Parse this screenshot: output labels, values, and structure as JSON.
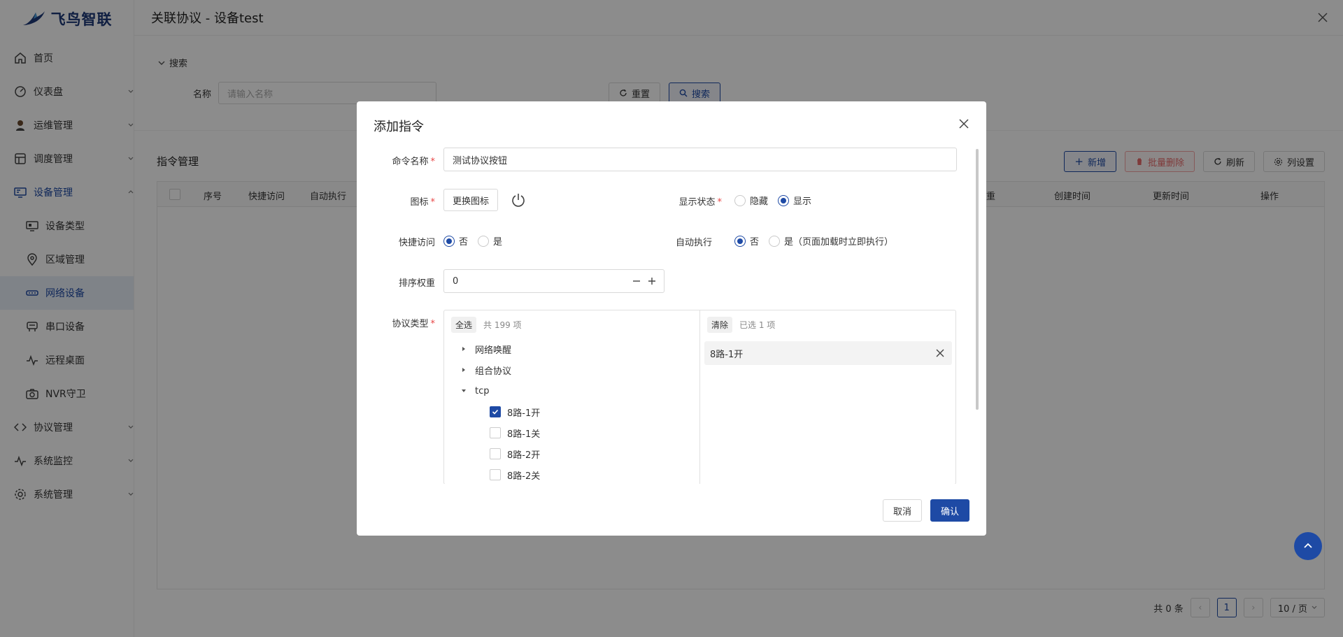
{
  "app": {
    "brand": "飞鸟智联",
    "brand_color": "#1e4aa5"
  },
  "sidebar": {
    "items": [
      {
        "label": "首页",
        "icon": "home-icon"
      },
      {
        "label": "仪表盘",
        "icon": "dashboard-icon"
      },
      {
        "label": "运维管理",
        "icon": "user-ops-icon"
      },
      {
        "label": "调度管理",
        "icon": "schedule-icon"
      },
      {
        "label": "设备管理",
        "icon": "monitor-icon"
      },
      {
        "label": "设备类型",
        "icon": "device-type-icon"
      },
      {
        "label": "区域管理",
        "icon": "location-icon"
      },
      {
        "label": "网络设备",
        "icon": "network-icon"
      },
      {
        "label": "串口设备",
        "icon": "serial-icon"
      },
      {
        "label": "远程桌面",
        "icon": "pulse-icon"
      },
      {
        "label": "NVR守卫",
        "icon": "camera-icon"
      },
      {
        "label": "协议管理",
        "icon": "code-icon"
      },
      {
        "label": "系统监控",
        "icon": "activity-icon"
      },
      {
        "label": "系统管理",
        "icon": "gear-icon"
      }
    ]
  },
  "drawer": {
    "title": "关联协议 - 设备test",
    "search_toggle": "搜索",
    "search": {
      "label": "名称",
      "placeholder": "请输入名称",
      "reset": "重置",
      "submit": "搜索"
    },
    "list_title": "指令管理",
    "toolbar": {
      "add": "新增",
      "batch_delete": "批量删除",
      "refresh": "刷新",
      "columns": "列设置"
    },
    "table_headers": [
      "序号",
      "快捷访问",
      "自动执行",
      "重",
      "创建时间",
      "更新时间",
      "操作"
    ],
    "pager": {
      "total": "共 0 条",
      "current": "1",
      "size": "10 / 页"
    }
  },
  "modal": {
    "title": "添加指令",
    "name": {
      "label": "命令名称",
      "value": "测试协议按钮"
    },
    "icon": {
      "label": "图标",
      "button": "更换图标"
    },
    "display": {
      "label": "显示状态",
      "options": [
        "隐藏",
        "显示"
      ],
      "selected": 1
    },
    "quick": {
      "label": "快捷访问",
      "options": [
        "否",
        "是"
      ],
      "selected": 0
    },
    "auto": {
      "label": "自动执行",
      "options": [
        "否",
        "是（页面加载时立即执行）"
      ],
      "selected": 0
    },
    "sort": {
      "label": "排序权重",
      "value": "0"
    },
    "protocol": {
      "label": "协议类型",
      "left": {
        "select_all": "全选",
        "count": "共 199 项"
      },
      "right": {
        "clear": "清除",
        "count": "已选 1 项"
      },
      "tree": [
        {
          "label": "网络唤醒",
          "expanded": false
        },
        {
          "label": "组合协议",
          "expanded": false
        },
        {
          "label": "tcp",
          "expanded": true,
          "children": [
            {
              "label": "8路-1开",
              "checked": true
            },
            {
              "label": "8路-1关",
              "checked": false
            },
            {
              "label": "8路-2开",
              "checked": false
            },
            {
              "label": "8路-2关",
              "checked": false
            }
          ]
        }
      ],
      "selected": [
        "8路-1开"
      ]
    },
    "footer": {
      "cancel": "取消",
      "confirm": "确认"
    }
  }
}
